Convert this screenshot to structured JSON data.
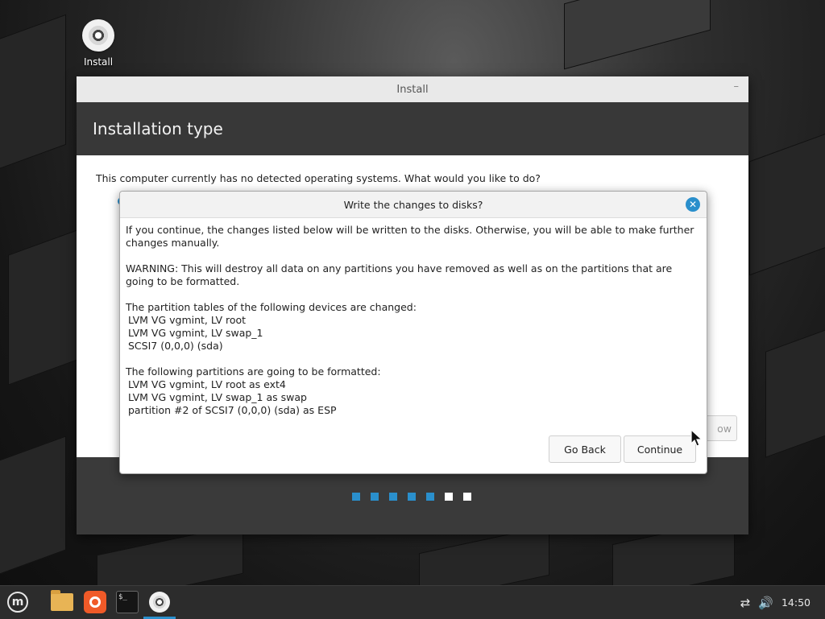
{
  "desktop": {
    "icon_label": "Install"
  },
  "window": {
    "title": "Install",
    "minimize_glyph": "–",
    "header_title": "Installation type",
    "question": "This computer currently has no detected operating systems. What would you like to do?",
    "behind_button_text": "ow",
    "progress_steps_done": 5,
    "progress_steps_total": 7
  },
  "dialog": {
    "title": "Write the changes to disks?",
    "close_glyph": "✕",
    "intro": "If you continue, the changes listed below will be written to the disks. Otherwise, you will be able to make further changes manually.",
    "warning": "WARNING: This will destroy all data on any partitions you have removed as well as on the partitions that are going to be formatted.",
    "tables_heading": "The partition tables of the following devices are changed:",
    "tables": [
      "LVM VG vgmint, LV root",
      "LVM VG vgmint, LV swap_1",
      "SCSI7 (0,0,0) (sda)"
    ],
    "format_heading": "The following partitions are going to be formatted:",
    "formats": [
      "LVM VG vgmint, LV root as ext4",
      "LVM VG vgmint, LV swap_1 as swap",
      "partition #2 of SCSI7 (0,0,0) (sda) as ESP"
    ],
    "go_back_label": "Go Back",
    "continue_label": "Continue"
  },
  "taskbar": {
    "apps": [
      "menu",
      "files",
      "firefox",
      "terminal",
      "install"
    ],
    "terminal_glyph": "$_",
    "network_icon": "network-disconnected-icon",
    "volume_icon": "volume-icon",
    "clock": "14:50"
  },
  "colors": {
    "accent": "#2a8fcc",
    "header_bg": "#383838",
    "footer_bg": "#3a3a3a"
  }
}
